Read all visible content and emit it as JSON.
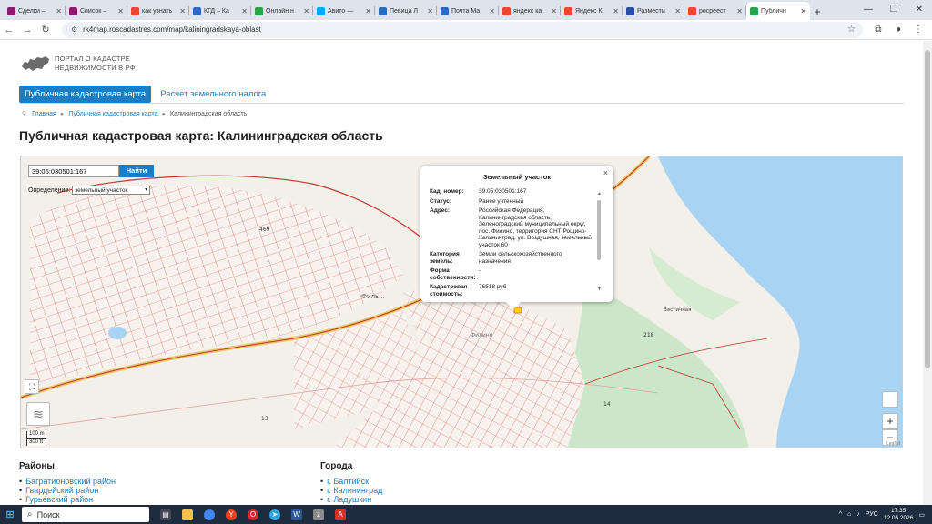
{
  "browser": {
    "tabs": [
      {
        "title": "Сделки –",
        "color": "#8a1b6e",
        "active": false
      },
      {
        "title": "Список –",
        "color": "#8a1b6e",
        "active": false
      },
      {
        "title": "как узнать",
        "color": "#e43",
        "active": false
      },
      {
        "title": "КГД – Ка",
        "color": "#2a6ebb",
        "active": false
      },
      {
        "title": "Онлайн н",
        "color": "#2aa34a",
        "active": false
      },
      {
        "title": "Авито —",
        "color": "#00aaff",
        "active": false
      },
      {
        "title": "Певица Л",
        "color": "#2a6ebb",
        "active": false
      },
      {
        "title": "Почта Ма",
        "color": "#2a6ebb",
        "active": false
      },
      {
        "title": "яндекс ка",
        "color": "#e43",
        "active": false
      },
      {
        "title": "Яндекс К",
        "color": "#e43",
        "active": false
      },
      {
        "title": "Размести",
        "color": "#2a4fa8",
        "active": false
      },
      {
        "title": "росреест",
        "color": "#e43",
        "active": false
      },
      {
        "title": "Публичн",
        "color": "#2aa34a",
        "active": true
      }
    ],
    "new_tab": "+",
    "url": "rk4map.roscadastres.com/map/kaliningradskaya-oblast"
  },
  "site": {
    "logo_line1": "ПОРТАЛ О КАДАСТРЕ",
    "logo_line2": "НЕДВИЖИМОСТИ В РФ",
    "menu_active": "Публичная кадастровая карта",
    "menu_link": "Расчет земельного налога",
    "crumb_home": "Главная",
    "crumb_map": "Публичная кадастровая карта",
    "crumb_region": "Калининградская область",
    "page_title": "Публичная кадастровая карта: Калининградская область"
  },
  "map": {
    "search_value": "39:05:030501:167",
    "search_button": "Найти",
    "definition_label": "Определение:",
    "definition_value": "земельный участок",
    "scale_m": "100 m",
    "scale_ft": "300 ft",
    "zoom_in": "+",
    "zoom_out": "−",
    "attribution": "Leaflet",
    "labels": {
      "fil": "Филь...",
      "filino": "Филино",
      "vastichnaya": "Вастичная",
      "n218": "218",
      "n469": "469",
      "n13": "13",
      "n14": "14"
    }
  },
  "popup": {
    "title": "Земельный участок",
    "close": "×",
    "rows": [
      {
        "k": "Кад. номер:",
        "v": "39:05:030501:167"
      },
      {
        "k": "Статус:",
        "v": "Ранее учтенный"
      },
      {
        "k": "Адрес:",
        "v": "Российская Федерация, Калининградская область, Зеленоградский муниципальный округ, пос. Филино, территория СНТ Рощино-Калининград, ул. Воздушная, земельный участок 60"
      },
      {
        "k": "Категория земель:",
        "v": "Земли сельскохозяйственного назначения"
      },
      {
        "k": "Форма собственности:",
        "v": "-"
      },
      {
        "k": "Кадастровая стоимость:",
        "v": "76518 руб"
      }
    ]
  },
  "districts": {
    "title": "Районы",
    "items": [
      "Багратионовский район",
      "Гвардейский район",
      "Гурьевский район"
    ]
  },
  "cities": {
    "title": "Города",
    "items": [
      "г. Балтийск",
      "г. Калининград",
      "г. Ладушкин"
    ]
  },
  "taskbar": {
    "search_label": "Поиск",
    "lang": "РУС",
    "time": "17:35",
    "date": "12.05.2026"
  }
}
